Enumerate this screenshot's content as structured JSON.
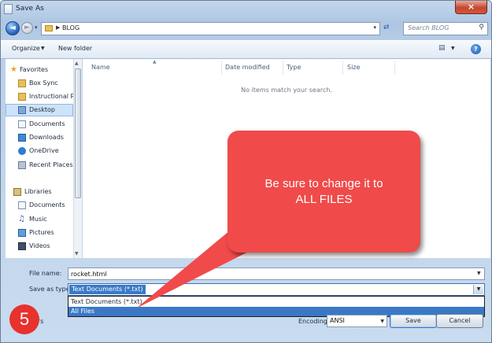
{
  "window": {
    "title": "Save As",
    "close_glyph": "×"
  },
  "navbar": {
    "back_glyph": "◄",
    "forward_glyph": "►",
    "address": "BLOG",
    "search_placeholder": "Search BLOG"
  },
  "toolbar": {
    "organize": "Organize",
    "new_folder": "New folder",
    "help": "?"
  },
  "sidebar": {
    "favorites_header": "Favorites",
    "favorites": [
      {
        "label": "Box Sync",
        "icon": "folder-icon"
      },
      {
        "label": "Instructional Res",
        "icon": "folder-icon"
      },
      {
        "label": "Desktop",
        "icon": "desktop-icon",
        "selected": true
      },
      {
        "label": "Documents",
        "icon": "documents-icon"
      },
      {
        "label": "Downloads",
        "icon": "downloads-icon"
      },
      {
        "label": "OneDrive",
        "icon": "cloud-icon"
      },
      {
        "label": "Recent Places",
        "icon": "recent-places-icon"
      }
    ],
    "libraries_header": "Libraries",
    "libraries": [
      {
        "label": "Documents",
        "icon": "documents-icon"
      },
      {
        "label": "Music",
        "icon": "music-icon"
      },
      {
        "label": "Pictures",
        "icon": "pictures-icon"
      },
      {
        "label": "Videos",
        "icon": "videos-icon"
      }
    ]
  },
  "file_list": {
    "columns": [
      "Name",
      "Date modified",
      "Type",
      "Size"
    ],
    "empty_message": "No items match your search."
  },
  "form": {
    "file_name_label": "File name:",
    "file_name_value": "rocket.html",
    "save_as_type_label": "Save as type:",
    "save_as_type_value": "Text Documents (*.txt)",
    "type_options": [
      "Text Documents (*.txt)",
      "All Files"
    ],
    "highlighted_option": "All Files",
    "hide_folders": "ers",
    "encoding_label": "Encoding:",
    "encoding_value": "ANSI",
    "save_button": "Save",
    "cancel_button": "Cancel"
  },
  "annotation": {
    "callout_line1": "Be sure to change it to",
    "callout_line2": "ALL FILES",
    "step_number": "5",
    "callout_color": "#f04a4a",
    "badge_color": "#e7322d"
  }
}
